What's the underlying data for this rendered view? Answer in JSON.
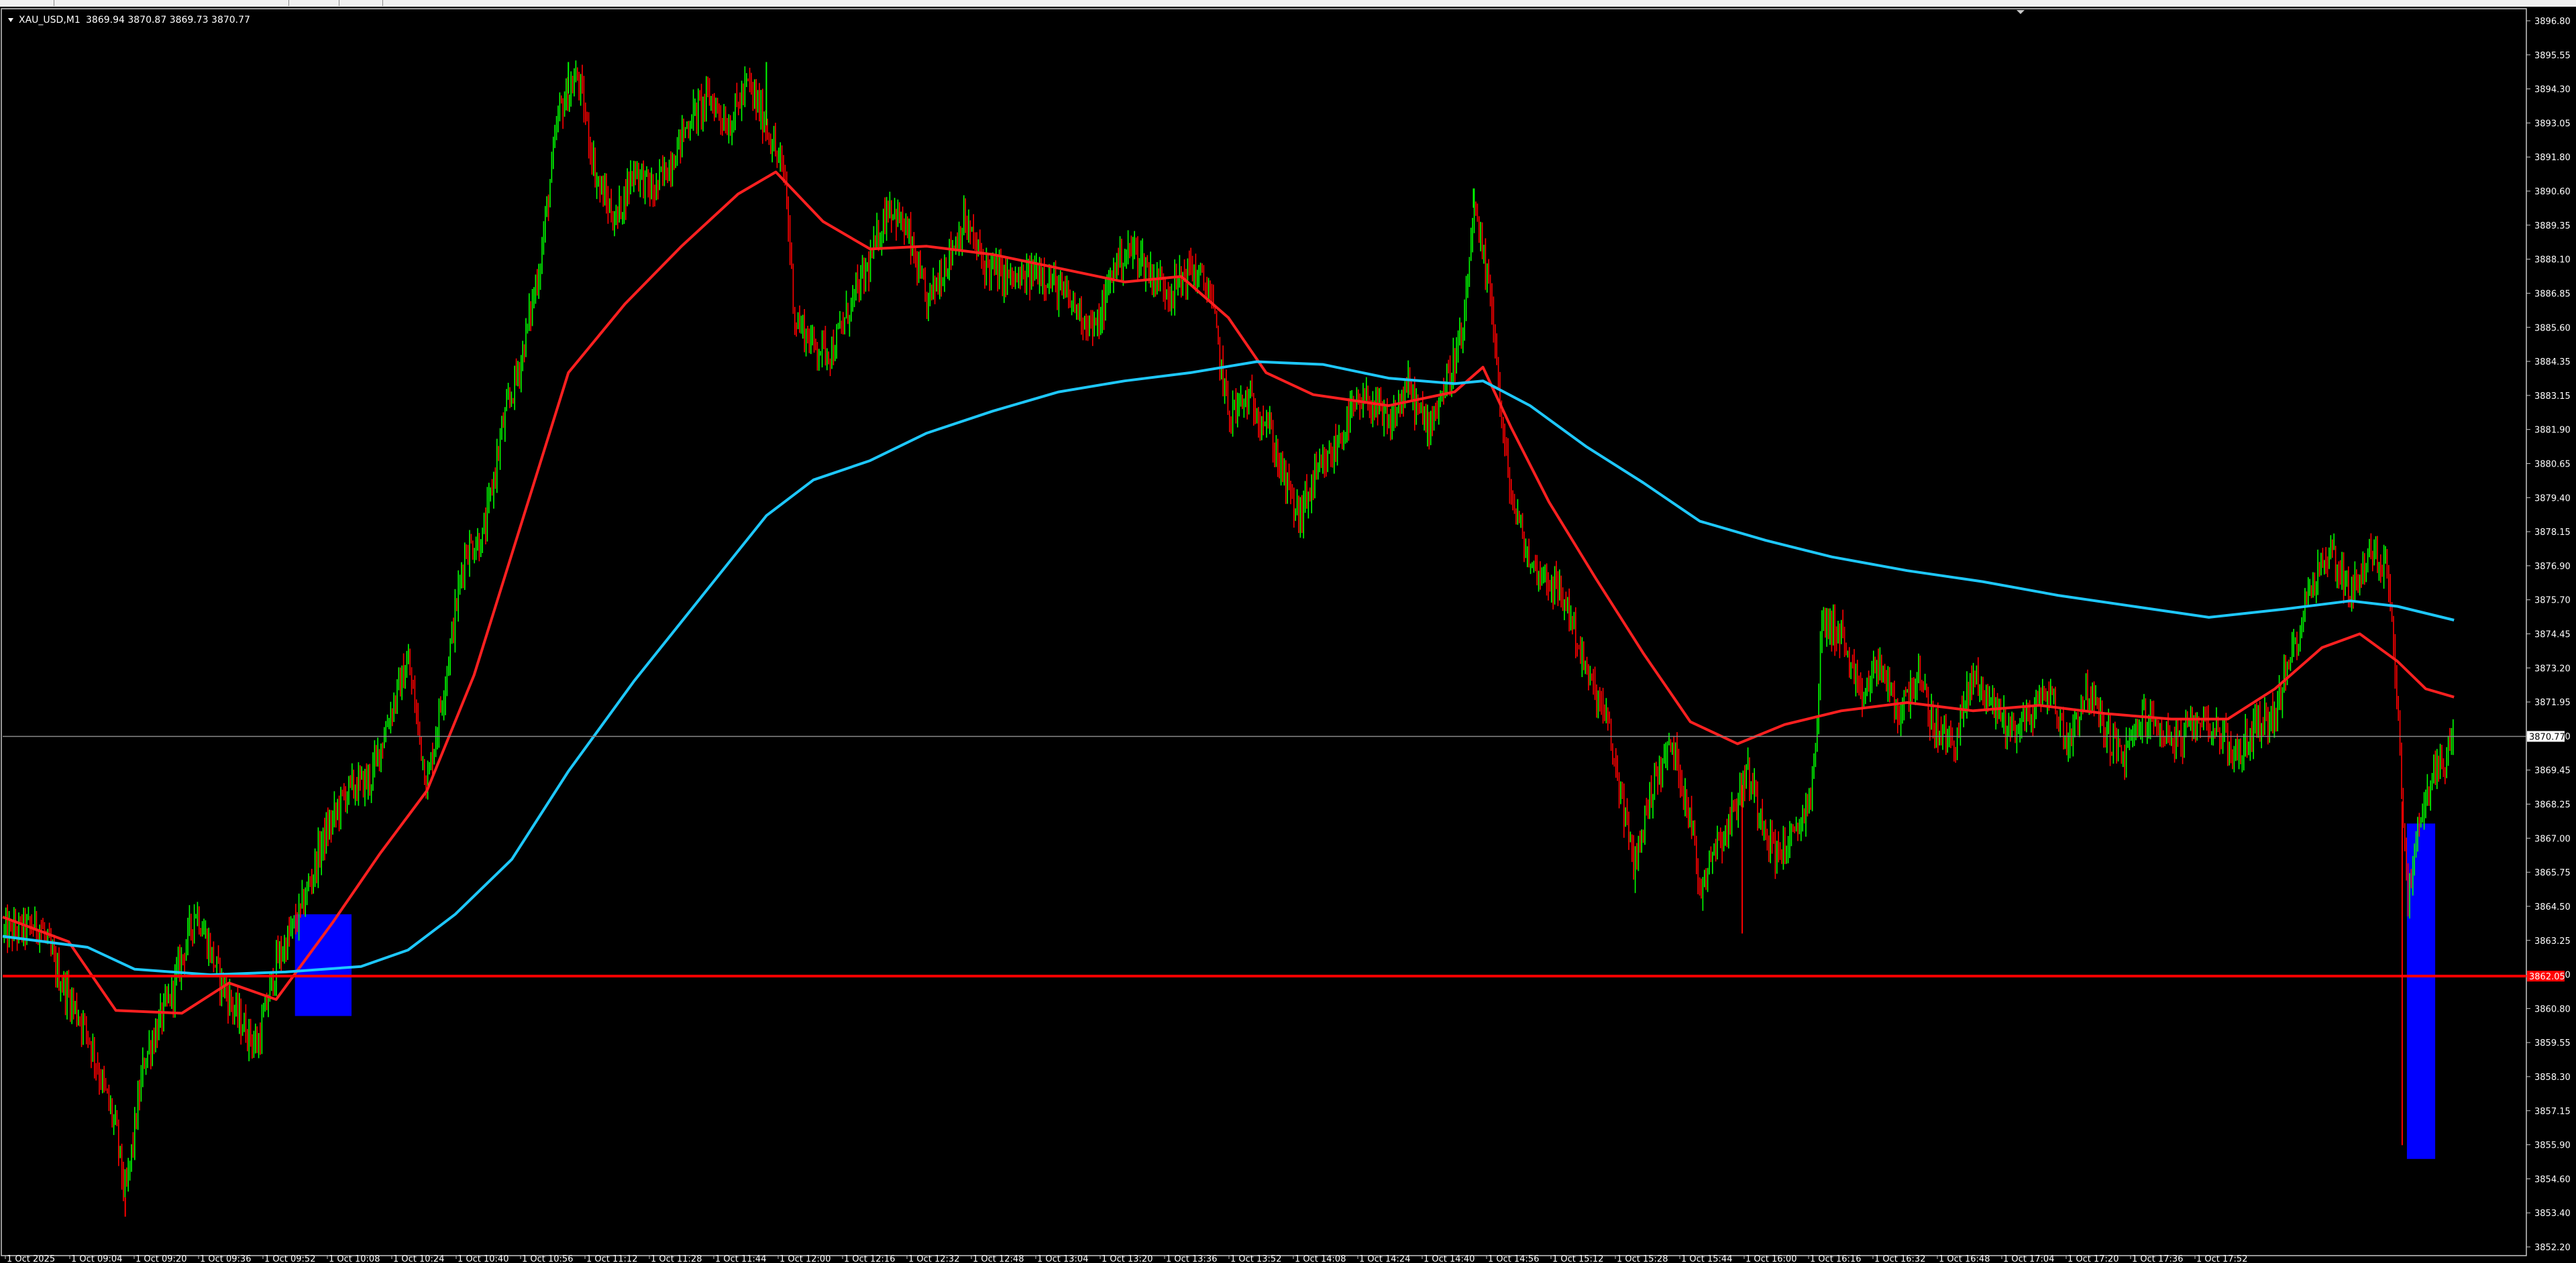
{
  "header": {
    "symbol": "XAU_USD,M1",
    "ohlc": "3869.94 3870.87 3869.73 3870.77"
  },
  "price_axis": {
    "ticks": [
      "3896.80",
      "3895.55",
      "3894.30",
      "3893.05",
      "3891.80",
      "3890.60",
      "3889.35",
      "3888.10",
      "3886.85",
      "3885.60",
      "3884.35",
      "3883.15",
      "3881.90",
      "3880.65",
      "3879.40",
      "3878.15",
      "3876.90",
      "3875.70",
      "3874.45",
      "3873.20",
      "3871.95",
      "3870.70",
      "3869.45",
      "3868.25",
      "3867.00",
      "3865.75",
      "3864.50",
      "3863.25",
      "3862.00",
      "3860.80",
      "3859.55",
      "3858.30",
      "3857.15",
      "3855.90",
      "3854.60",
      "3853.40",
      "3852.20"
    ],
    "current_price_label": "3870.77",
    "level_label": "3862.05"
  },
  "time_axis": {
    "labels": [
      "1 Oct 2025",
      "1 Oct 09:04",
      "1 Oct 09:20",
      "1 Oct 09:36",
      "1 Oct 09:52",
      "1 Oct 10:08",
      "1 Oct 10:24",
      "1 Oct 10:40",
      "1 Oct 10:56",
      "1 Oct 11:12",
      "1 Oct 11:28",
      "1 Oct 11:44",
      "1 Oct 12:00",
      "1 Oct 12:16",
      "1 Oct 12:32",
      "1 Oct 12:48",
      "1 Oct 13:04",
      "1 Oct 13:20",
      "1 Oct 13:36",
      "1 Oct 13:52",
      "1 Oct 14:08",
      "1 Oct 14:24",
      "1 Oct 14:40",
      "1 Oct 14:56",
      "1 Oct 15:12",
      "1 Oct 15:28",
      "1 Oct 15:44",
      "1 Oct 16:00",
      "1 Oct 16:16",
      "1 Oct 16:32",
      "1 Oct 16:48",
      "1 Oct 17:04",
      "1 Oct 17:20",
      "1 Oct 17:36",
      "1 Oct 17:52"
    ]
  },
  "colors": {
    "background": "#000000",
    "bull": "#00ff00",
    "bear": "#ff0000",
    "ma_fast": "#ff2020",
    "ma_slow": "#1ec8ff",
    "zone": "#0000ff",
    "level": "#ff0000",
    "bid_line": "#8a8a8a",
    "axis_text": "#ffffff"
  },
  "chart_data": {
    "type": "candlestick",
    "symbol": "XAU_USD",
    "timeframe": "M1",
    "ylim": [
      3852.2,
      3896.8
    ],
    "x_range": [
      "1 Oct 2025 08:52",
      "1 Oct 2025 18:01"
    ],
    "last_close": 3870.77,
    "horizontal_level": 3862.05,
    "price_path": [
      [
        "1 Oct 2025 08:52",
        3863.6
      ],
      [
        "1 Oct 2025 09:00",
        3863.9
      ],
      [
        "1 Oct 2025 09:04",
        3862.0
      ],
      [
        "1 Oct 2025 09:10",
        3860.0
      ],
      [
        "1 Oct 2025 09:16",
        3856.5
      ],
      [
        "1 Oct 2025 09:18",
        3854.0
      ],
      [
        "1 Oct 2025 09:22",
        3859.0
      ],
      [
        "1 Oct 2025 09:28",
        3861.5
      ],
      [
        "1 Oct 2025 09:33",
        3864.5
      ],
      [
        "1 Oct 2025 09:38",
        3862.0
      ],
      [
        "1 Oct 2025 09:42",
        3860.5
      ],
      [
        "1 Oct 2025 09:46",
        3859.5
      ],
      [
        "1 Oct 2025 09:50",
        3862.5
      ],
      [
        "1 Oct 2025 09:55",
        3864.3
      ],
      [
        "1 Oct 2025 10:00",
        3867.0
      ],
      [
        "1 Oct 2025 10:05",
        3868.8
      ],
      [
        "1 Oct 2025 10:10",
        3869.2
      ],
      [
        "1 Oct 2025 10:14",
        3871.5
      ],
      [
        "1 Oct 2025 10:18",
        3873.5
      ],
      [
        "1 Oct 2025 10:22",
        3869.0
      ],
      [
        "1 Oct 2025 10:26",
        3873.0
      ],
      [
        "1 Oct 2025 10:30",
        3877.5
      ],
      [
        "1 Oct 2025 10:34",
        3878.0
      ],
      [
        "1 Oct 2025 10:38",
        3882.0
      ],
      [
        "1 Oct 2025 10:42",
        3884.5
      ],
      [
        "1 Oct 2025 10:46",
        3888.0
      ],
      [
        "1 Oct 2025 10:50",
        3893.5
      ],
      [
        "1 Oct 2025 10:54",
        3894.8
      ],
      [
        "1 Oct 2025 10:58",
        3891.0
      ],
      [
        "1 Oct 2025 11:02",
        3889.5
      ],
      [
        "1 Oct 2025 11:06",
        3891.5
      ],
      [
        "1 Oct 2025 11:10",
        3890.5
      ],
      [
        "1 Oct 2025 11:14",
        3891.8
      ],
      [
        "1 Oct 2025 11:18",
        3893.3
      ],
      [
        "1 Oct 2025 11:22",
        3894.0
      ],
      [
        "1 Oct 2025 11:26",
        3893.0
      ],
      [
        "1 Oct 2025 11:30",
        3894.5
      ],
      [
        "1 Oct 2025 11:34",
        3893.0
      ],
      [
        "1 Oct 2025 11:38",
        3891.0
      ],
      [
        "1 Oct 2025 11:40",
        3886.0
      ],
      [
        "1 Oct 2025 11:44",
        3885.0
      ],
      [
        "1 Oct 2025 11:48",
        3884.8
      ],
      [
        "1 Oct 2025 11:52",
        3886.5
      ],
      [
        "1 Oct 2025 11:56",
        3888.0
      ],
      [
        "1 Oct 2025 12:00",
        3890.2
      ],
      [
        "1 Oct 2025 12:04",
        3889.0
      ],
      [
        "1 Oct 2025 12:08",
        3886.5
      ],
      [
        "1 Oct 2025 12:12",
        3888.0
      ],
      [
        "1 Oct 2025 12:16",
        3889.5
      ],
      [
        "1 Oct 2025 12:20",
        3888.0
      ],
      [
        "1 Oct 2025 12:24",
        3887.5
      ],
      [
        "1 Oct 2025 12:28",
        3887.3
      ],
      [
        "1 Oct 2025 12:32",
        3887.8
      ],
      [
        "1 Oct 2025 12:36",
        3887.0
      ],
      [
        "1 Oct 2025 12:40",
        3886.3
      ],
      [
        "1 Oct 2025 12:44",
        3885.5
      ],
      [
        "1 Oct 2025 12:48",
        3888.0
      ],
      [
        "1 Oct 2025 12:52",
        3888.5
      ],
      [
        "1 Oct 2025 12:56",
        3887.5
      ],
      [
        "1 Oct 2025 13:00",
        3887.0
      ],
      [
        "1 Oct 2025 13:04",
        3887.8
      ],
      [
        "1 Oct 2025 13:08",
        3887.0
      ],
      [
        "1 Oct 2025 13:12",
        3882.5
      ],
      [
        "1 Oct 2025 13:16",
        3883.0
      ],
      [
        "1 Oct 2025 13:20",
        3882.3
      ],
      [
        "1 Oct 2025 13:24",
        3880.0
      ],
      [
        "1 Oct 2025 13:27",
        3878.7
      ],
      [
        "1 Oct 2025 13:30",
        3880.0
      ],
      [
        "1 Oct 2025 13:34",
        3881.0
      ],
      [
        "1 Oct 2025 13:38",
        3882.5
      ],
      [
        "1 Oct 2025 13:42",
        3883.0
      ],
      [
        "1 Oct 2025 13:46",
        3882.0
      ],
      [
        "1 Oct 2025 13:50",
        3883.5
      ],
      [
        "1 Oct 2025 13:54",
        3882.0
      ],
      [
        "1 Oct 2025 13:58",
        3883.5
      ],
      [
        "1 Oct 2025 14:02",
        3885.5
      ],
      [
        "1 Oct 2025 14:04",
        3890.0
      ],
      [
        "1 Oct 2025 14:06",
        3888.0
      ],
      [
        "1 Oct 2025 14:08",
        3886.5
      ],
      [
        "1 Oct 2025 14:10",
        3882.0
      ],
      [
        "1 Oct 2025 14:12",
        3879.5
      ],
      [
        "1 Oct 2025 14:16",
        3877.0
      ],
      [
        "1 Oct 2025 14:20",
        3876.5
      ],
      [
        "1 Oct 2025 14:24",
        3875.5
      ],
      [
        "1 Oct 2025 14:28",
        3873.0
      ],
      [
        "1 Oct 2025 14:32",
        3871.5
      ],
      [
        "1 Oct 2025 14:36",
        3868.0
      ],
      [
        "1 Oct 2025 14:38",
        3866.0
      ],
      [
        "1 Oct 2025 14:42",
        3869.0
      ],
      [
        "1 Oct 2025 14:46",
        3870.5
      ],
      [
        "1 Oct 2025 14:50",
        3868.0
      ],
      [
        "1 Oct 2025 14:52",
        3865.0
      ],
      [
        "1 Oct 2025 14:54",
        3866.5
      ],
      [
        "1 Oct 2025 14:58",
        3867.5
      ],
      [
        "1 Oct 2025 15:02",
        3869.5
      ],
      [
        "1 Oct 2025 15:04",
        3868.5
      ],
      [
        "1 Oct 2025 15:08",
        3866.5
      ],
      [
        "1 Oct 2025 15:12",
        3867.0
      ],
      [
        "1 Oct 2025 15:16",
        3869.0
      ],
      [
        "1 Oct 2025 15:18",
        3875.0
      ],
      [
        "1 Oct 2025 15:22",
        3874.5
      ],
      [
        "1 Oct 2025 15:26",
        3872.0
      ],
      [
        "1 Oct 2025 15:30",
        3873.5
      ],
      [
        "1 Oct 2025 15:34",
        3871.5
      ],
      [
        "1 Oct 2025 15:38",
        3873.0
      ],
      [
        "1 Oct 2025 15:42",
        3871.0
      ],
      [
        "1 Oct 2025 15:46",
        3870.5
      ],
      [
        "1 Oct 2025 15:50",
        3873.0
      ],
      [
        "1 Oct 2025 15:54",
        3872.0
      ],
      [
        "1 Oct 2025 15:58",
        3871.0
      ],
      [
        "1 Oct 2025 16:02",
        3871.5
      ],
      [
        "1 Oct 2025 16:06",
        3872.5
      ],
      [
        "1 Oct 2025 16:10",
        3870.5
      ],
      [
        "1 Oct 2025 16:14",
        3872.5
      ],
      [
        "1 Oct 2025 16:18",
        3871.0
      ],
      [
        "1 Oct 2025 16:22",
        3870.0
      ],
      [
        "1 Oct 2025 16:26",
        3871.5
      ],
      [
        "1 Oct 2025 16:30",
        3871.0
      ],
      [
        "1 Oct 2025 16:34",
        3870.5
      ],
      [
        "1 Oct 2025 16:38",
        3871.5
      ],
      [
        "1 Oct 2025 16:42",
        3871.0
      ],
      [
        "1 Oct 2025 16:46",
        3870.0
      ],
      [
        "1 Oct 2025 16:50",
        3871.2
      ],
      [
        "1 Oct 2025 16:54",
        3871.5
      ],
      [
        "1 Oct 2025 16:58",
        3874.0
      ],
      [
        "1 Oct 2025 17:02",
        3876.5
      ],
      [
        "1 Oct 2025 17:06",
        3877.5
      ],
      [
        "1 Oct 2025 17:10",
        3876.0
      ],
      [
        "1 Oct 2025 17:14",
        3877.3
      ],
      [
        "1 Oct 2025 17:18",
        3877.0
      ],
      [
        "1 Oct 2025 17:20",
        3872.0
      ],
      [
        "1 Oct 2025 17:22",
        3864.8
      ],
      [
        "1 Oct 2025 17:24",
        3867.0
      ],
      [
        "1 Oct 2025 17:26",
        3868.5
      ],
      [
        "1 Oct 2025 17:28",
        3869.5
      ],
      [
        "1 Oct 2025 17:30",
        3870.0
      ],
      [
        "1 Oct 2025 17:32",
        3870.77
      ]
    ],
    "extremes": [
      {
        "time": "1 Oct 2025 09:18",
        "low": 3853.3
      },
      {
        "time": "1 Oct 2025 10:52",
        "high": 3895.3
      },
      {
        "time": "1 Oct 2025 11:34",
        "high": 3895.3
      },
      {
        "time": "1 Oct 2025 14:04",
        "high": 3890.7
      },
      {
        "time": "1 Oct 2025 15:01",
        "low": 3863.6
      },
      {
        "time": "1 Oct 2025 17:21",
        "low": 3855.9
      }
    ],
    "series": [
      {
        "type": "line",
        "values": [
          [
            "1 Oct 2025 08:52",
            3864.2
          ],
          [
            "1 Oct 2025 09:06",
            3863.3
          ],
          [
            "1 Oct 2025 09:16",
            3860.8
          ],
          [
            "1 Oct 2025 09:30",
            3860.7
          ],
          [
            "1 Oct 2025 09:40",
            3861.8
          ],
          [
            "1 Oct 2025 09:50",
            3861.2
          ],
          [
            "1 Oct 2025 10:02",
            3864.0
          ],
          [
            "1 Oct 2025 10:12",
            3866.5
          ],
          [
            "1 Oct 2025 10:22",
            3868.8
          ],
          [
            "1 Oct 2025 10:32",
            3873.0
          ],
          [
            "1 Oct 2025 10:42",
            3878.5
          ],
          [
            "1 Oct 2025 10:52",
            3884.0
          ],
          [
            "1 Oct 2025 11:04",
            3886.5
          ],
          [
            "1 Oct 2025 11:16",
            3888.6
          ],
          [
            "1 Oct 2025 11:28",
            3890.5
          ],
          [
            "1 Oct 2025 11:36",
            3891.3
          ],
          [
            "1 Oct 2025 11:46",
            3889.5
          ],
          [
            "1 Oct 2025 11:56",
            3888.5
          ],
          [
            "1 Oct 2025 12:08",
            3888.6
          ],
          [
            "1 Oct 2025 12:22",
            3888.3
          ],
          [
            "1 Oct 2025 12:36",
            3887.8
          ],
          [
            "1 Oct 2025 12:50",
            3887.3
          ],
          [
            "1 Oct 2025 13:02",
            3887.5
          ],
          [
            "1 Oct 2025 13:12",
            3886.0
          ],
          [
            "1 Oct 2025 13:20",
            3884.0
          ],
          [
            "1 Oct 2025 13:30",
            3883.2
          ],
          [
            "1 Oct 2025 13:46",
            3882.8
          ],
          [
            "1 Oct 2025 14:00",
            3883.3
          ],
          [
            "1 Oct 2025 14:06",
            3884.2
          ],
          [
            "1 Oct 2025 14:12",
            3882.0
          ],
          [
            "1 Oct 2025 14:20",
            3879.3
          ],
          [
            "1 Oct 2025 14:30",
            3876.5
          ],
          [
            "1 Oct 2025 14:40",
            3873.8
          ],
          [
            "1 Oct 2025 14:50",
            3871.3
          ],
          [
            "1 Oct 2025 15:00",
            3870.5
          ],
          [
            "1 Oct 2025 15:10",
            3871.2
          ],
          [
            "1 Oct 2025 15:22",
            3871.7
          ],
          [
            "1 Oct 2025 15:36",
            3872.0
          ],
          [
            "1 Oct 2025 15:50",
            3871.7
          ],
          [
            "1 Oct 2025 16:04",
            3871.9
          ],
          [
            "1 Oct 2025 16:18",
            3871.6
          ],
          [
            "1 Oct 2025 16:32",
            3871.4
          ],
          [
            "1 Oct 2025 16:44",
            3871.4
          ],
          [
            "1 Oct 2025 16:54",
            3872.5
          ],
          [
            "1 Oct 2025 17:04",
            3874.0
          ],
          [
            "1 Oct 2025 17:12",
            3874.5
          ],
          [
            "1 Oct 2025 17:20",
            3873.5
          ],
          [
            "1 Oct 2025 17:26",
            3872.5
          ],
          [
            "1 Oct 2025 17:32",
            3872.2
          ]
        ]
      },
      {
        "type": "line",
        "values": [
          [
            "1 Oct 2025 08:52",
            3863.5
          ],
          [
            "1 Oct 2025 09:10",
            3863.1
          ],
          [
            "1 Oct 2025 09:20",
            3862.3
          ],
          [
            "1 Oct 2025 09:36",
            3862.1
          ],
          [
            "1 Oct 2025 09:52",
            3862.2
          ],
          [
            "1 Oct 2025 10:08",
            3862.4
          ],
          [
            "1 Oct 2025 10:18",
            3863.0
          ],
          [
            "1 Oct 2025 10:28",
            3864.3
          ],
          [
            "1 Oct 2025 10:40",
            3866.3
          ],
          [
            "1 Oct 2025 10:52",
            3869.5
          ],
          [
            "1 Oct 2025 11:06",
            3872.8
          ],
          [
            "1 Oct 2025 11:20",
            3875.8
          ],
          [
            "1 Oct 2025 11:34",
            3878.8
          ],
          [
            "1 Oct 2025 11:44",
            3880.1
          ],
          [
            "1 Oct 2025 11:56",
            3880.8
          ],
          [
            "1 Oct 2025 12:08",
            3881.8
          ],
          [
            "1 Oct 2025 12:22",
            3882.6
          ],
          [
            "1 Oct 2025 12:36",
            3883.3
          ],
          [
            "1 Oct 2025 12:50",
            3883.7
          ],
          [
            "1 Oct 2025 13:04",
            3884.0
          ],
          [
            "1 Oct 2025 13:18",
            3884.4
          ],
          [
            "1 Oct 2025 13:32",
            3884.3
          ],
          [
            "1 Oct 2025 13:46",
            3883.8
          ],
          [
            "1 Oct 2025 14:00",
            3883.6
          ],
          [
            "1 Oct 2025 14:06",
            3883.7
          ],
          [
            "1 Oct 2025 14:16",
            3882.8
          ],
          [
            "1 Oct 2025 14:28",
            3881.3
          ],
          [
            "1 Oct 2025 14:40",
            3880.0
          ],
          [
            "1 Oct 2025 14:52",
            3878.6
          ],
          [
            "1 Oct 2025 15:06",
            3877.9
          ],
          [
            "1 Oct 2025 15:20",
            3877.3
          ],
          [
            "1 Oct 2025 15:36",
            3876.8
          ],
          [
            "1 Oct 2025 15:52",
            3876.4
          ],
          [
            "1 Oct 2025 16:08",
            3875.9
          ],
          [
            "1 Oct 2025 16:24",
            3875.5
          ],
          [
            "1 Oct 2025 16:40",
            3875.1
          ],
          [
            "1 Oct 2025 16:56",
            3875.4
          ],
          [
            "1 Oct 2025 17:10",
            3875.7
          ],
          [
            "1 Oct 2025 17:20",
            3875.5
          ],
          [
            "1 Oct 2025 17:32",
            3875.0
          ]
        ]
      }
    ],
    "zones": [
      {
        "t0": "1 Oct 2025 09:54",
        "t1": "1 Oct 2025 10:06",
        "top": 3864.3,
        "bottom": 3860.6
      },
      {
        "t0": "1 Oct 2025 17:22",
        "t1": "1 Oct 2025 17:28",
        "top": 3867.6,
        "bottom": 3855.4
      }
    ],
    "grid": false
  }
}
